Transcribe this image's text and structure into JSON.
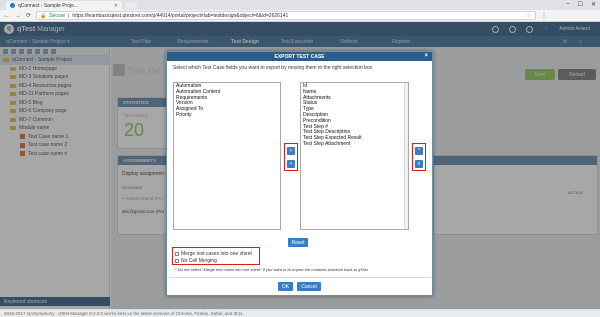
{
  "browser": {
    "tab_title": "qConnect - Sample Proje...",
    "secure_label": "Secure",
    "url": "https://learnbasicqtest.qtestnet.com/p/44914/portal/project#tab=testdesign&object=6&id=2626141"
  },
  "app": {
    "brand": "qTest",
    "product": "Manager",
    "user": "Ashish Anand",
    "project": "qConnect - Sample Project",
    "nav": [
      "Test Plan",
      "Requirements",
      "Test Design",
      "Test Execution",
      "Defects",
      "Reports"
    ],
    "active_nav": "Test Design"
  },
  "tree": {
    "root": "qConnect - Sample Project",
    "items": [
      {
        "label": "MD-2 Homepage",
        "type": "folder"
      },
      {
        "label": "MD-3 Solutions pages",
        "type": "folder"
      },
      {
        "label": "MD-4 Resources pages",
        "type": "folder"
      },
      {
        "label": "MD-11 Partners pages",
        "type": "folder"
      },
      {
        "label": "MD-5 Blog",
        "type": "folder"
      },
      {
        "label": "MD-6 Company page",
        "type": "folder"
      },
      {
        "label": "MD-7 Common",
        "type": "folder"
      },
      {
        "label": "Module name",
        "type": "folder"
      },
      {
        "label": "Test Case name 1",
        "type": "tc"
      },
      {
        "label": "Test case name 2",
        "type": "tc"
      },
      {
        "label": "Test case name n",
        "type": "tc"
      }
    ],
    "keyboard_shortcuts": "Keyboard shortcuts"
  },
  "background": {
    "page_title": "Test De",
    "save": "Save",
    "reload": "Reload",
    "statistics_header": "STATISTICS",
    "testcases_label": "TESTCASES",
    "testcases_count": "20",
    "assignments_header": "ASSIGNMENTS",
    "display_assignments": "Display assignmen",
    "assignee_col": "ASSIGNEE",
    "action_col": "ACTION",
    "assignee_input": "+ Ashish Anand (Pro",
    "email": "abc@gmail.com (Pro",
    "footer": "2015-2017 QASymphony . qTest Manager 8.3.3.0 works best on the latest versions of Chrome, Firefox, Safari, and IE11."
  },
  "modal": {
    "title": "EXPORT TEST CASE",
    "instruction": "Select which Test Case fields you want to export by moving them to the right selection box",
    "left_fields": [
      "Automation",
      "Automation Content",
      "Requirements",
      "Version",
      "Assigned To",
      "Priority"
    ],
    "right_fields": [
      "Id",
      "Name",
      "Attachments",
      "Status",
      "Type",
      "Description",
      "Precondition",
      "Test Step #",
      "Test Step Description",
      "Test Step Expected Result",
      "Test Step Attachment"
    ],
    "move_right": ">",
    "move_left": "<",
    "move_up": "^",
    "move_down": "v",
    "reset": "Reset",
    "merge_label": "Merge test cases into one sheet",
    "no_cell_merge_label": "No Cell Merging",
    "note": "* Do not select \"Merge test cases into one sheet\" if you want to re-import the modules structure back to qTest",
    "ok": "OK",
    "cancel": "Cancel",
    "close": "×"
  },
  "colors": {
    "header_blue": "#2d5d86",
    "button_blue": "#3b7dc4",
    "highlight_red": "#d32020",
    "save_green": "#8cc64f"
  }
}
